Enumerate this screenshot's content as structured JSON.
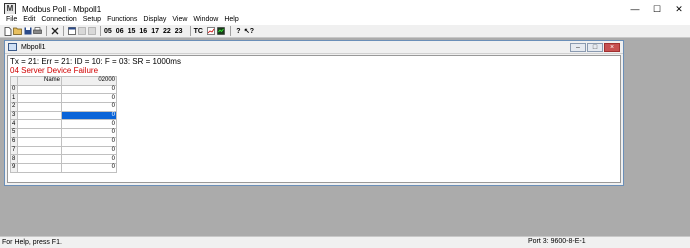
{
  "window": {
    "title": "Modbus Poll - Mbpoll1",
    "icon": "modbus-app-icon",
    "caption_buttons": [
      "minimize",
      "maximize",
      "close"
    ]
  },
  "menu": [
    "File",
    "Edit",
    "Connection",
    "Setup",
    "Functions",
    "Display",
    "View",
    "Window",
    "Help"
  ],
  "toolbar": {
    "icons": [
      "new-icon",
      "open-icon",
      "save-icon",
      "print-icon",
      "delete-icon",
      "window-icon",
      "connect-icon",
      "disconnect-icon"
    ],
    "function_codes": [
      "05",
      "06",
      "15",
      "16",
      "17",
      "22",
      "23"
    ],
    "tc_label": "TC",
    "right_icons": [
      "chart-icon",
      "monitor-icon",
      "help-icon",
      "context-help-icon"
    ]
  },
  "child": {
    "title": "Mbpoll1",
    "status_line": "Tx = 21: Err = 21: ID = 10: F = 03: SR = 1000ms",
    "error_line": "04 Server Device Failure",
    "grid": {
      "name_header": "Name",
      "value_header": "02000",
      "selected_row": 3,
      "rows": [
        {
          "index": "0",
          "name": "",
          "value": "0"
        },
        {
          "index": "1",
          "name": "",
          "value": "0"
        },
        {
          "index": "2",
          "name": "",
          "value": "0"
        },
        {
          "index": "3",
          "name": "",
          "value": "0"
        },
        {
          "index": "4",
          "name": "",
          "value": "0"
        },
        {
          "index": "5",
          "name": "",
          "value": "0"
        },
        {
          "index": "6",
          "name": "",
          "value": "0"
        },
        {
          "index": "7",
          "name": "",
          "value": "0"
        },
        {
          "index": "8",
          "name": "",
          "value": "0"
        },
        {
          "index": "9",
          "name": "",
          "value": "0"
        }
      ]
    }
  },
  "statusbar": {
    "left": "For Help, press F1.",
    "right": "Port 3: 9600-8-E-1"
  },
  "colors": {
    "error_text": "#d00000",
    "selection": "#0a64d8"
  }
}
